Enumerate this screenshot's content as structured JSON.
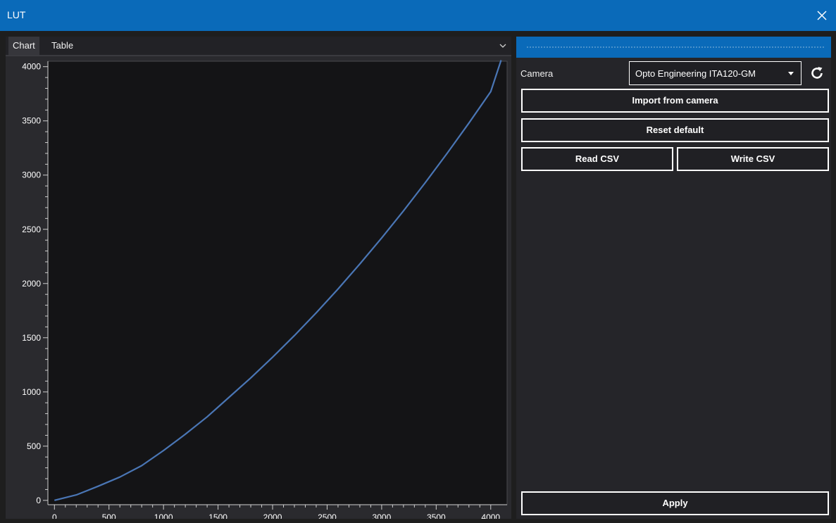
{
  "window": {
    "title": "LUT",
    "close_icon": "close-icon"
  },
  "tabs": [
    {
      "label": "Chart"
    },
    {
      "label": "Table"
    }
  ],
  "panel": {
    "camera_label": "Camera",
    "camera_value": "Opto Engineering ITA120-GM",
    "import_label": "Import from camera",
    "reset_label": "Reset default",
    "read_csv_label": "Read CSV",
    "write_csv_label": "Write CSV",
    "apply_label": "Apply"
  },
  "colors": {
    "accent": "#0a6ab9",
    "line": "#4a76b5"
  },
  "chart_data": {
    "type": "line",
    "x_ticks": [
      "0",
      "500",
      "1000",
      "1500",
      "2000",
      "2500",
      "3000",
      "3500",
      "4000"
    ],
    "y_ticks": [
      "0",
      "500",
      "1000",
      "1500",
      "2000",
      "2500",
      "3000",
      "3500",
      "4000"
    ],
    "xlim": [
      -60,
      4150
    ],
    "ylim": [
      -40,
      4050
    ],
    "series": [
      {
        "x": [
          0,
          200,
          400,
          600,
          800,
          1000,
          1200,
          1400,
          1600,
          1800,
          2000,
          2200,
          2400,
          2600,
          2800,
          3000,
          3200,
          3400,
          3600,
          3800,
          4000,
          4095
        ],
        "y": [
          0,
          50,
          130,
          215,
          320,
          460,
          610,
          770,
          950,
          1130,
          1320,
          1520,
          1730,
          1950,
          2180,
          2420,
          2670,
          2930,
          3200,
          3480,
          3770,
          4060
        ]
      }
    ]
  }
}
